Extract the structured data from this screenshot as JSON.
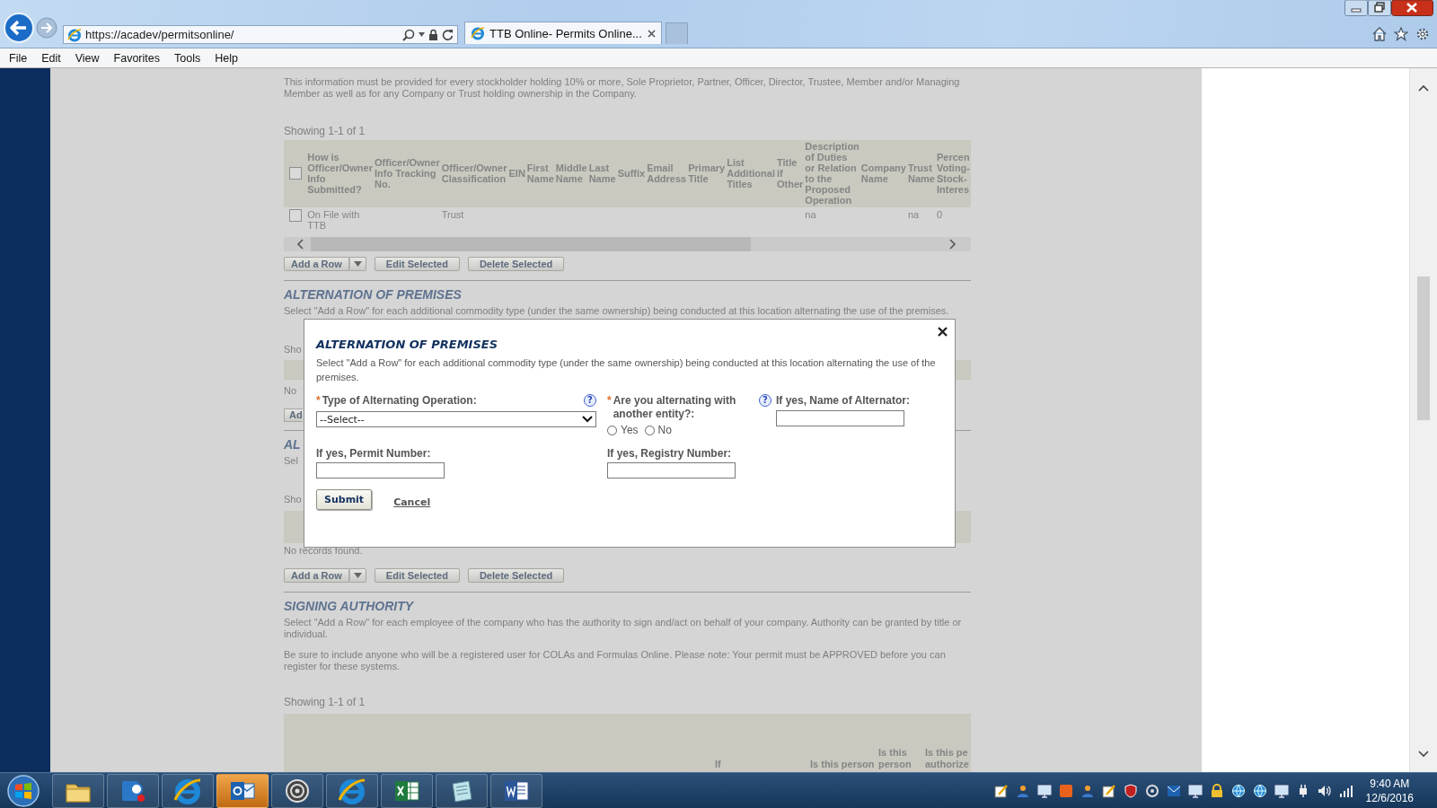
{
  "browser": {
    "address": "https://acadev/permitsonline/",
    "tabs": [
      {
        "title": "TTB Online- Permits Online...",
        "selected": true
      }
    ]
  },
  "menu": [
    {
      "label": "File"
    },
    {
      "label": "Edit"
    },
    {
      "label": "View"
    },
    {
      "label": "Favorites"
    },
    {
      "label": "Tools"
    },
    {
      "label": "Help"
    }
  ],
  "page": {
    "intro": "This information must be provided for every stockholder holding 10% or more, Sole Proprietor, Partner, Officer, Director, Trustee, Member and/or Managing Member as well as for any Company or Trust holding ownership in the Company.",
    "owners_table": {
      "showing": "Showing 1-1 of 1",
      "select_all": {
        "checked": false
      },
      "columns": [
        "How is\nOfficer/Owner\nInfo\nSubmitted?",
        "Officer/Owner\nInfo Tracking\nNo.",
        "Officer/Owner\nClassification",
        "EIN",
        "First\nName",
        "Middle\nName",
        "Last\nName",
        "Suffix",
        "Email\nAddress",
        "Primary\nTitle",
        "List\nAdditional\nTitles",
        "Title\nif\nOther",
        "Description\nof Duties\nor Relation\nto the\nProposed\nOperation",
        "Company\nName",
        "Trust\nName",
        "Percen\nVoting-\nStock-\nInteres"
      ],
      "rows": [
        {
          "checked": false,
          "cells": [
            "On File with\nTTB",
            "",
            "Trust",
            "",
            "",
            "",
            "",
            "",
            "",
            "",
            "",
            "",
            "na",
            "",
            "na",
            "0"
          ]
        }
      ]
    },
    "owners_buttons": [
      {
        "label": "Add a Row",
        "menu": true
      },
      {
        "label": "Edit Selected",
        "menu": false
      },
      {
        "label": "Delete Selected",
        "menu": false
      }
    ],
    "alternation": {
      "heading": "ALTERNATION OF PREMISES",
      "description": "Select \"Add a Row\" for each additional commodity type (under the same ownership) being conducted at this location alternating the use of the premises.",
      "showing": "Sho",
      "empty": "No",
      "add_button": "Ad"
    },
    "next_section": {
      "heading": "AL",
      "description": "Sel",
      "showing": "Sho",
      "empty": "No records found.",
      "buttons": [
        {
          "label": "Add a Row",
          "menu": true
        },
        {
          "label": "Edit Selected",
          "menu": false
        },
        {
          "label": "Delete Selected",
          "menu": false
        }
      ]
    },
    "signing_authority": {
      "heading": "SIGNING AUTHORITY",
      "paragraphs": [
        "Select \"Add a Row\" for each employee of the company who has the authority to sign and/act on behalf of your company. Authority can be granted by title or individual.",
        "Be sure to include anyone who will be a registered user for COLAs and Formulas Online. Please note: Your permit must be APPROVED before you can register for these systems."
      ],
      "showing": "Showing 1-1 of 1",
      "columns": [
        "If",
        "Is this person",
        "Is this\nperson",
        "Is this pe\nauthorize"
      ]
    }
  },
  "dialog": {
    "title": "ALTERNATION OF PREMISES",
    "description": "Select \"Add a Row\" for each additional commodity type (under the same ownership) being conducted at this location alternating the use of the premises.",
    "fields": [
      {
        "kind": "select",
        "required_mark": "*",
        "label": "Type of Alternating Operation:",
        "help": "?",
        "value": "--Select--"
      },
      {
        "kind": "radio",
        "required_mark": "*",
        "label": "Are you alternating with another entity?:",
        "help": "?",
        "options": [
          {
            "label": "Yes",
            "selected": false
          },
          {
            "label": "No",
            "selected": false
          }
        ]
      },
      {
        "kind": "text",
        "label": "If yes, Name of Alternator:"
      },
      {
        "kind": "text",
        "label": "If yes, Permit Number:"
      },
      {
        "kind": "text",
        "label": "If yes, Registry Number:"
      }
    ],
    "actions": [
      {
        "kind": "button",
        "label": "Submit"
      },
      {
        "kind": "link",
        "label": "Cancel"
      }
    ]
  },
  "taskbar": {
    "apps": [
      {
        "kind": "folder",
        "highlighted": false
      },
      {
        "kind": "chat",
        "highlighted": false
      },
      {
        "kind": "browser",
        "highlighted": false
      },
      {
        "kind": "mail",
        "highlighted": true
      },
      {
        "kind": "target",
        "highlighted": false
      },
      {
        "kind": "browser",
        "highlighted": false
      },
      {
        "kind": "spreadsheet",
        "highlighted": false
      },
      {
        "kind": "notepad",
        "highlighted": false
      },
      {
        "kind": "document",
        "highlighted": false
      }
    ],
    "tray": [
      {
        "kind": "note"
      },
      {
        "kind": "person"
      },
      {
        "kind": "screen"
      },
      {
        "kind": "square"
      },
      {
        "kind": "person"
      },
      {
        "kind": "note"
      },
      {
        "kind": "shield"
      },
      {
        "kind": "ring"
      },
      {
        "kind": "mail"
      },
      {
        "kind": "screen"
      },
      {
        "kind": "lock"
      },
      {
        "kind": "globe"
      },
      {
        "kind": "globe"
      },
      {
        "kind": "screen"
      },
      {
        "kind": "plug"
      },
      {
        "kind": "speaker"
      },
      {
        "kind": "signal"
      }
    ],
    "time": "9:40 AM",
    "date": "12/6/2016"
  }
}
